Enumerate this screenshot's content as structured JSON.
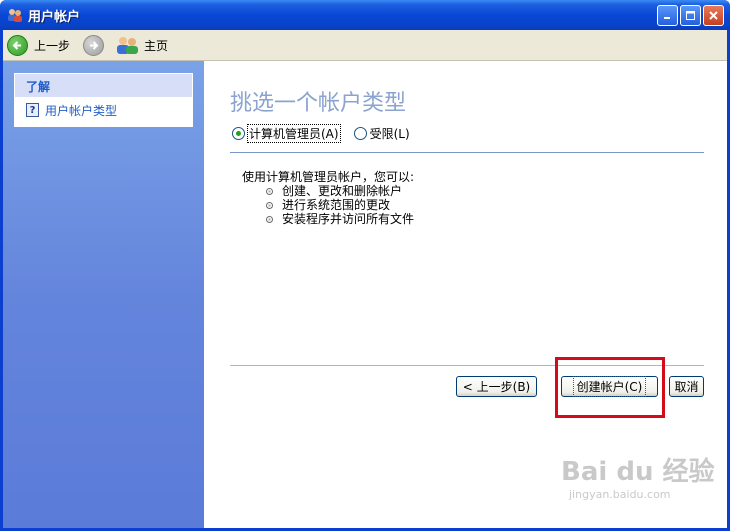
{
  "window": {
    "title": "用户帐户"
  },
  "toolbar": {
    "back_label": "上一步",
    "home_label": "主页"
  },
  "sidebar": {
    "section_title": "了解",
    "items": [
      {
        "label": "用户帐户类型",
        "icon": "help-icon"
      }
    ]
  },
  "main": {
    "heading": "挑选一个帐户类型",
    "options": [
      {
        "label": "计算机管理员(A)",
        "selected": true
      },
      {
        "label": "受限(L)",
        "selected": false
      }
    ],
    "description": "使用计算机管理员帐户，您可以:",
    "bullets": [
      "创建、更改和删除帐户",
      "进行系统范围的更改",
      "安装程序并访问所有文件"
    ]
  },
  "buttons": {
    "back": "< 上一步(B)",
    "create": "创建帐户(C)",
    "cancel": "取消"
  },
  "watermark": {
    "main": "Bai du 经验",
    "sub": "jingyan.baidu.com"
  },
  "colors": {
    "titlebar": "#0a47d6",
    "sidebar": "#6485dc",
    "heading": "#8aa3cf",
    "highlight_box": "#d40c1a"
  }
}
